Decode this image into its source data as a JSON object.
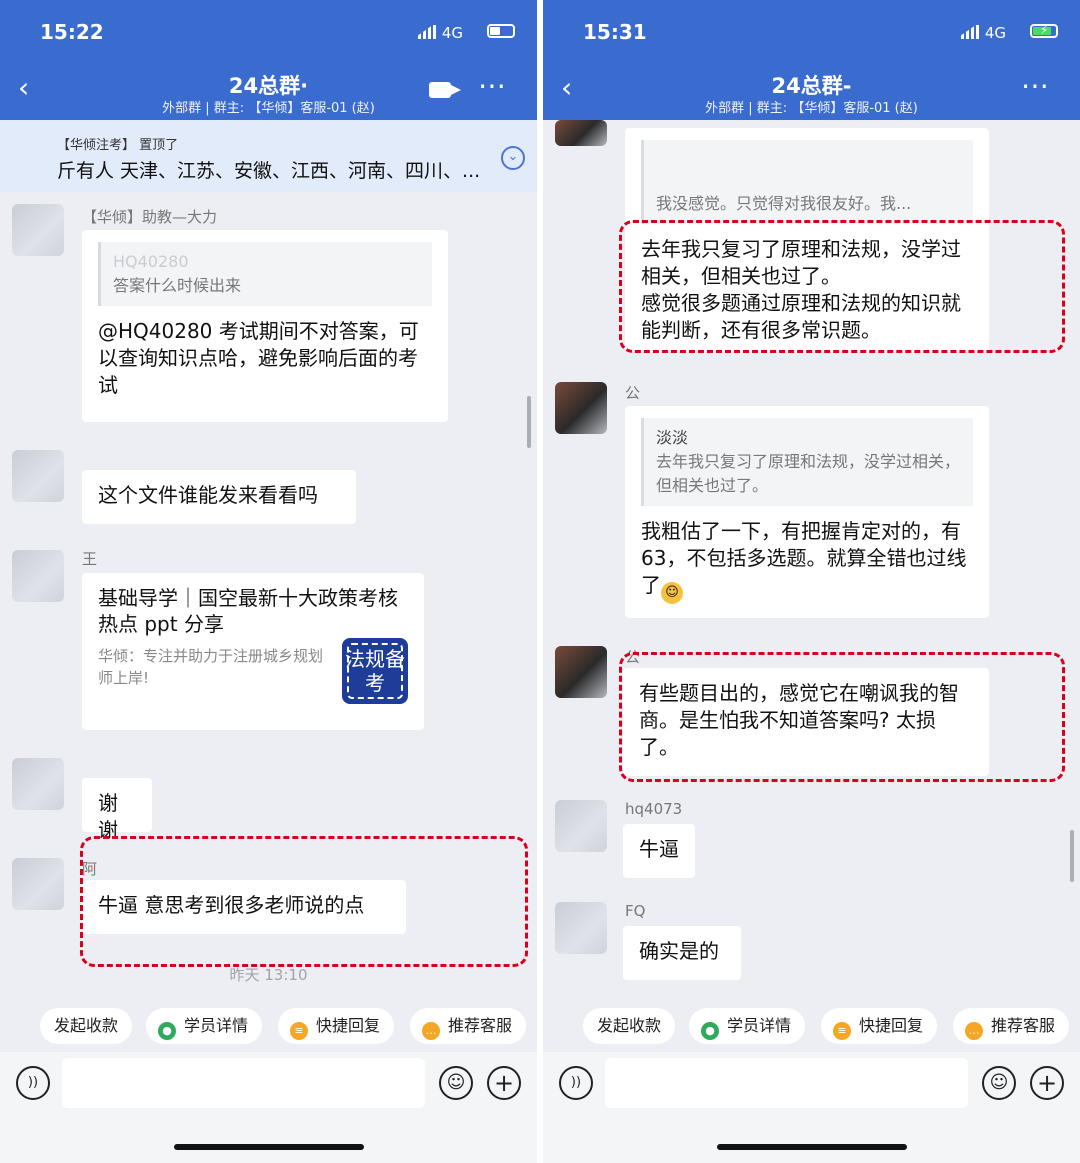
{
  "left": {
    "status": {
      "time": "15:22",
      "network": "4G"
    },
    "header": {
      "title": "24总群·",
      "subtitle": "外部群 | 群主: 【华倾】客服-01 (赵)"
    },
    "pinned": {
      "sender": "【华倾注考】 置顶了",
      "text": "斤有人 天津、江苏、安徽、江西、河南、四川、..."
    },
    "messages": {
      "m1": {
        "name": "【华倾】助教—大力",
        "quote_name": "HQ40280",
        "quote_text": "答案什么时候出来",
        "text": "@HQ40280 考试期间不对答案，可以查询知识点哈，避免影响后面的考试"
      },
      "m2": {
        "text": "这个文件谁能发来看看吗"
      },
      "m3": {
        "name": "王",
        "link_title": "基础导学｜国空最新十大政策考核热点 ppt 分享",
        "link_desc": "华倾：专注并助力于注册城乡规划师上岸!",
        "thumb": "法规备考"
      },
      "m4": {
        "text": "谢谢"
      },
      "m5": {
        "name": "阿",
        "text": "牛逼 意思考到很多老师说的点"
      }
    },
    "timestamp": "昨天 13:10"
  },
  "right": {
    "status": {
      "time": "15:31",
      "network": "4G"
    },
    "header": {
      "title": "24总群-",
      "subtitle": "外部群 | 群主: 【华倾】客服-01 (赵)"
    },
    "messages": {
      "m1": {
        "quote_text": "我没感觉。只觉得对我很友好。我...",
        "text": "去年我只复习了原理和法规，没学过相关，但相关也过了。\n感觉很多题通过原理和法规的知识就能判断，还有很多常识题。"
      },
      "m2": {
        "name": "公",
        "quote_name": "淡淡",
        "quote_text": "去年我只复习了原理和法规，没学过相关，但相关也过了。",
        "text": "我粗估了一下，有把握肯定对的，有63，不包括多选题。就算全错也过线了"
      },
      "m3": {
        "name": "公",
        "text": "有些题目出的，感觉它在嘲讽我的智商。是生怕我不知道答案吗? 太损了。"
      },
      "m4": {
        "name": "hq4073",
        "text": "牛逼"
      },
      "m5": {
        "name": "FQ",
        "text": "确实是的"
      }
    }
  },
  "chips": {
    "collect": "发起收款",
    "student": "学员详情",
    "quick_reply": "快捷回复",
    "recommend": "推荐客服"
  },
  "icons": {
    "back": "back-arrow-icon",
    "video": "video-call-icon",
    "more": "more-icon",
    "voice": "voice-icon",
    "emoji": "emoji-icon",
    "plus": "plus-icon",
    "expand": "chevron-down-icon"
  },
  "colors": {
    "header": "#3a6cd0",
    "highlight": "#d9001b",
    "background": "#eceef3"
  }
}
